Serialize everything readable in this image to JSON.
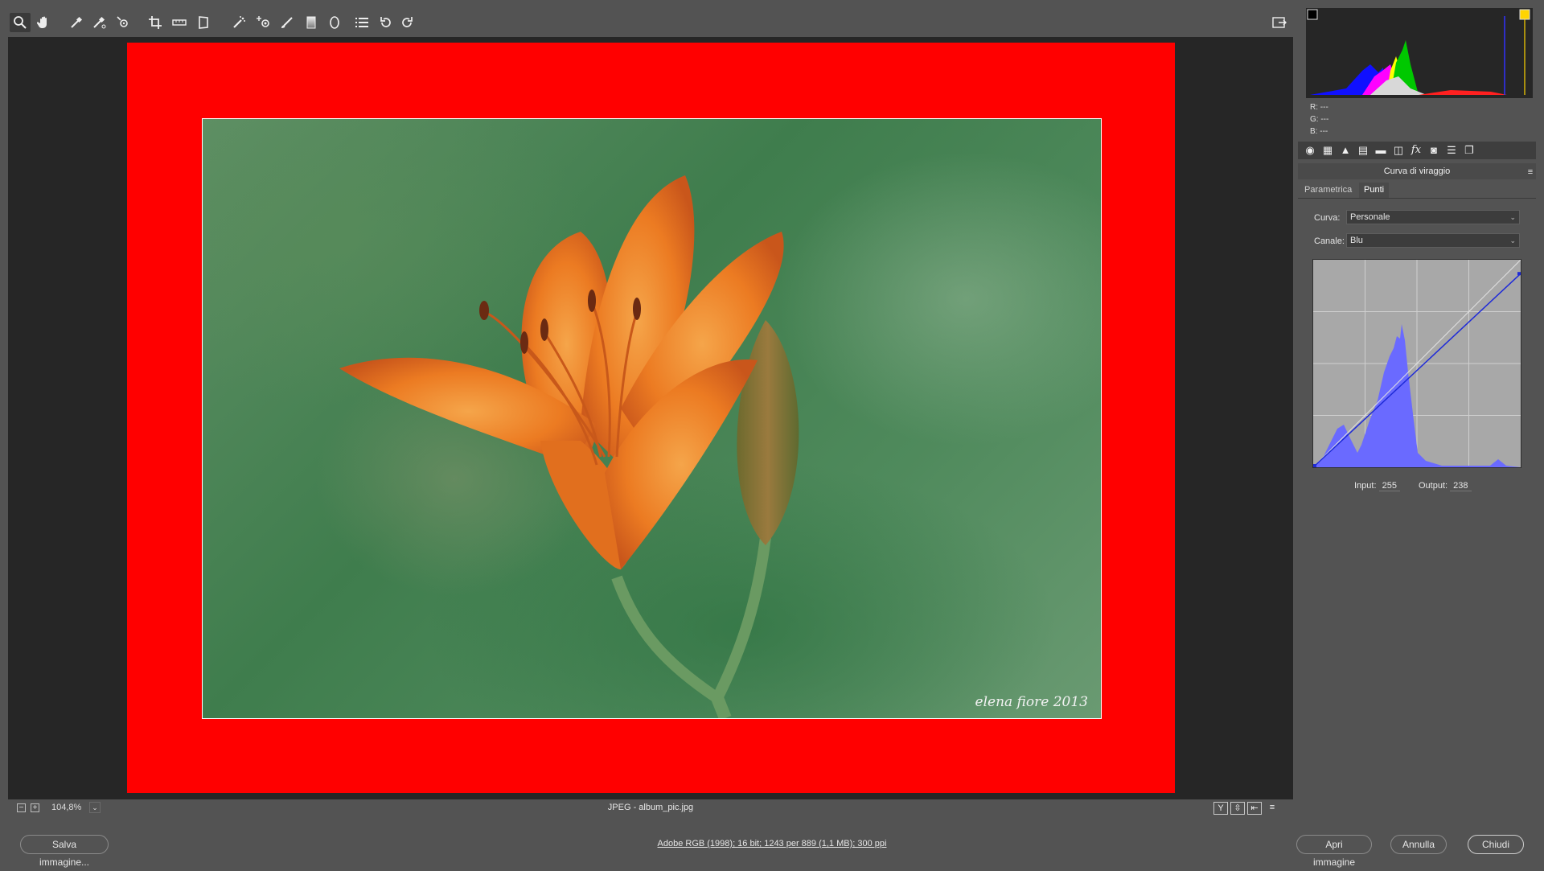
{
  "toolbar": {
    "tools": [
      {
        "name": "zoom-tool-icon",
        "active": true
      },
      {
        "name": "hand-tool-icon",
        "active": false
      },
      {
        "name": "white-balance-tool-icon",
        "active": false
      },
      {
        "name": "color-sampler-tool-icon",
        "active": false
      },
      {
        "name": "targeted-adjustment-tool-icon",
        "active": false
      },
      {
        "name": "crop-tool-icon",
        "active": false
      },
      {
        "name": "straighten-tool-icon",
        "active": false
      },
      {
        "name": "transform-tool-icon",
        "active": false
      },
      {
        "name": "spot-removal-tool-icon",
        "active": false
      },
      {
        "name": "red-eye-removal-icon",
        "active": false
      },
      {
        "name": "adjustment-brush-icon",
        "active": false
      },
      {
        "name": "graduated-filter-icon",
        "active": false
      },
      {
        "name": "radial-filter-icon",
        "active": false
      },
      {
        "name": "preferences-icon",
        "active": false
      },
      {
        "name": "rotate-left-icon",
        "active": false
      },
      {
        "name": "rotate-right-icon",
        "active": false
      }
    ],
    "fullscreen_icon": "toggle-fullscreen-icon"
  },
  "image": {
    "signature": "elena fiore 2013",
    "frame_color": "#ff0000"
  },
  "statusbar": {
    "zoom_out": "−",
    "zoom_in": "+",
    "zoom_value": "104,8%",
    "zoom_dropdown": "⌄",
    "file_info": "JPEG  -  album_pic.jpg",
    "view_buttons": [
      "Y",
      "⇳",
      "⇤",
      "≡"
    ]
  },
  "footer": {
    "save_label": "Salva immagine...",
    "workflow_info": "Adobe RGB (1998); 16 bit; 1243 per 889 (1,1 MB); 300 ppi",
    "open_label": "Apri immagine",
    "cancel_label": "Annulla",
    "close_label": "Chiudi"
  },
  "readout": {
    "r_label": "R:",
    "r_value": "---",
    "g_label": "G:",
    "g_value": "---",
    "b_label": "B:",
    "b_value": "---"
  },
  "panel": {
    "title": "Curva di viraggio",
    "tabs": [
      "Parametrica",
      "Punti"
    ],
    "selected_tab": "Punti",
    "curve_label": "Curva:",
    "curve_value": "Personale",
    "channel_label": "Canale:",
    "channel_value": "Blu",
    "input_label": "Input:",
    "input_value": "255",
    "output_label": "Output:",
    "output_value": "238",
    "curve_points": [
      [
        0,
        0
      ],
      [
        255,
        238
      ]
    ],
    "curve_color": "#1f2bd8",
    "histogram_color": "#6a6aff"
  }
}
